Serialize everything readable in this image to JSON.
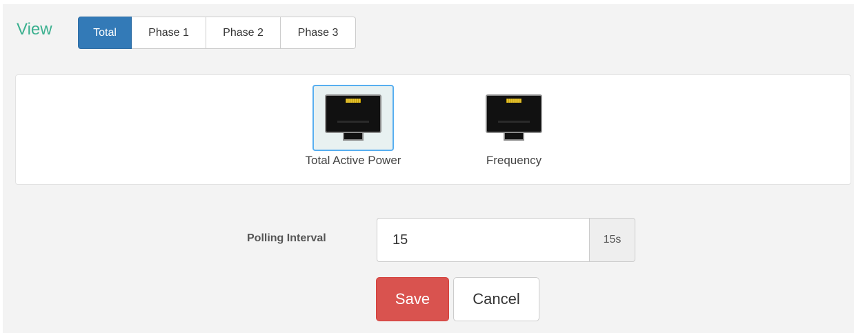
{
  "view": {
    "label": "View",
    "tabs": [
      {
        "label": "Total",
        "active": true
      },
      {
        "label": "Phase 1",
        "active": false
      },
      {
        "label": "Phase 2",
        "active": false
      },
      {
        "label": "Phase 3",
        "active": false
      }
    ]
  },
  "sensors": [
    {
      "label": "Total Active Power",
      "icon": "ethernet-port-icon",
      "selected": true
    },
    {
      "label": "Frequency",
      "icon": "ethernet-port-icon",
      "selected": false
    }
  ],
  "polling": {
    "label": "Polling Interval",
    "value": "15",
    "addon": "15s"
  },
  "actions": {
    "save_label": "Save",
    "cancel_label": "Cancel"
  },
  "colors": {
    "accent": "#337ab7",
    "view_label": "#3bb08f",
    "danger": "#d9534f",
    "selected_border": "#57aef0"
  }
}
